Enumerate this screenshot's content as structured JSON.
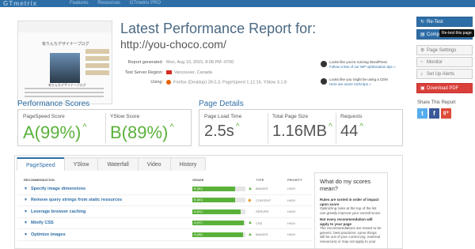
{
  "topbar": {
    "logo": "GTmetrix",
    "nav": [
      "Features",
      "Resources",
      "GTmetrix PRO"
    ]
  },
  "report": {
    "title": "Latest Performance Report for:",
    "url": "http://you-choco.com/",
    "generated_label": "Report generated:",
    "generated_value": "Mon, Aug 10, 2015, 8:08 PM -0700",
    "region_label": "Test Server Region:",
    "region_value": "Vancouver, Canada",
    "using_label": "Using:",
    "using_value": "Firefox (Desktop) 39.0.3, PageSpeed 1.12.16, YSlow 3.1.8"
  },
  "thumbnail": {
    "site_name": "有りんちデザイナーブログ",
    "caption": "有りんちデザイナーブログ"
  },
  "notes": [
    {
      "text": "Looks like you're running WordPress",
      "link": "Follow a few of our WP optimization tips »"
    },
    {
      "text": "Looks like you might be using a CDN",
      "link": "Here are some CDN tips »"
    }
  ],
  "performance_scores": {
    "title": "Performance Scores",
    "pagespeed_label": "PageSpeed Score",
    "pagespeed_value": "A(99%)",
    "yslow_label": "YSlow Score",
    "yslow_value": "B(89%)",
    "arrow": "^"
  },
  "page_details": {
    "title": "Page Details",
    "load_label": "Page Load Time",
    "load_value": "2.5s",
    "size_label": "Total Page Size",
    "size_value": "1.16MB",
    "requests_label": "Requests",
    "requests_value": "44",
    "arrow": "^"
  },
  "tabs": [
    "PageSpeed",
    "YSlow",
    "Waterfall",
    "Video",
    "History"
  ],
  "table": {
    "headers": [
      "RECOMMENDATION",
      "GRADE",
      "TYPE",
      "PRIORITY"
    ],
    "rows": [
      {
        "rec": "Specify image dimensions",
        "grade": "B (80)",
        "type": "IMAGES",
        "priority": "HIGH",
        "fill": 0.8,
        "icon": "up"
      },
      {
        "rec": "Remove query strings from static resources",
        "grade": "B (80)",
        "type": "CONTENT",
        "priority": "HIGH",
        "fill": 0.8,
        "icon": "warn"
      },
      {
        "rec": "Leverage browser caching",
        "grade": "A (91)",
        "type": "SERVER",
        "priority": "HIGH",
        "fill": 0.91,
        "icon": "none"
      },
      {
        "rec": "Minify CSS",
        "grade": "A (97)",
        "type": "CSS",
        "priority": "HIGH",
        "fill": 0.97,
        "icon": "up"
      },
      {
        "rec": "Optimize images",
        "grade": "A (96)",
        "type": "IMAGES",
        "priority": "HIGH",
        "fill": 0.96,
        "icon": "up"
      }
    ]
  },
  "scores_info": {
    "title": "What do my scores mean?",
    "p1_bold": "Rules are sorted in order of impact upon score",
    "p1_text": "Optimizing rules at the top of the list can greatly improve your overall score.",
    "p2_bold": "Not every recommendation will apply to your page",
    "p2_text": "The recommendations are meant to be generic, best practices; some things will be out of your control (eg. external resources) or may not apply to your"
  },
  "sidebar": {
    "retest": "Re-Test",
    "compare": "Compare",
    "tooltip": "Re-test this page",
    "settings": "Page Settings",
    "monitor": "Monitor",
    "alerts": "Set Up Alerts",
    "pdf": "Download PDF",
    "share_title": "Share This Report",
    "social": [
      "t",
      "f",
      "g+"
    ]
  },
  "colors": {
    "brand": "#2e6ea6",
    "good": "#5ab13a",
    "pdf": "#d9403a"
  }
}
